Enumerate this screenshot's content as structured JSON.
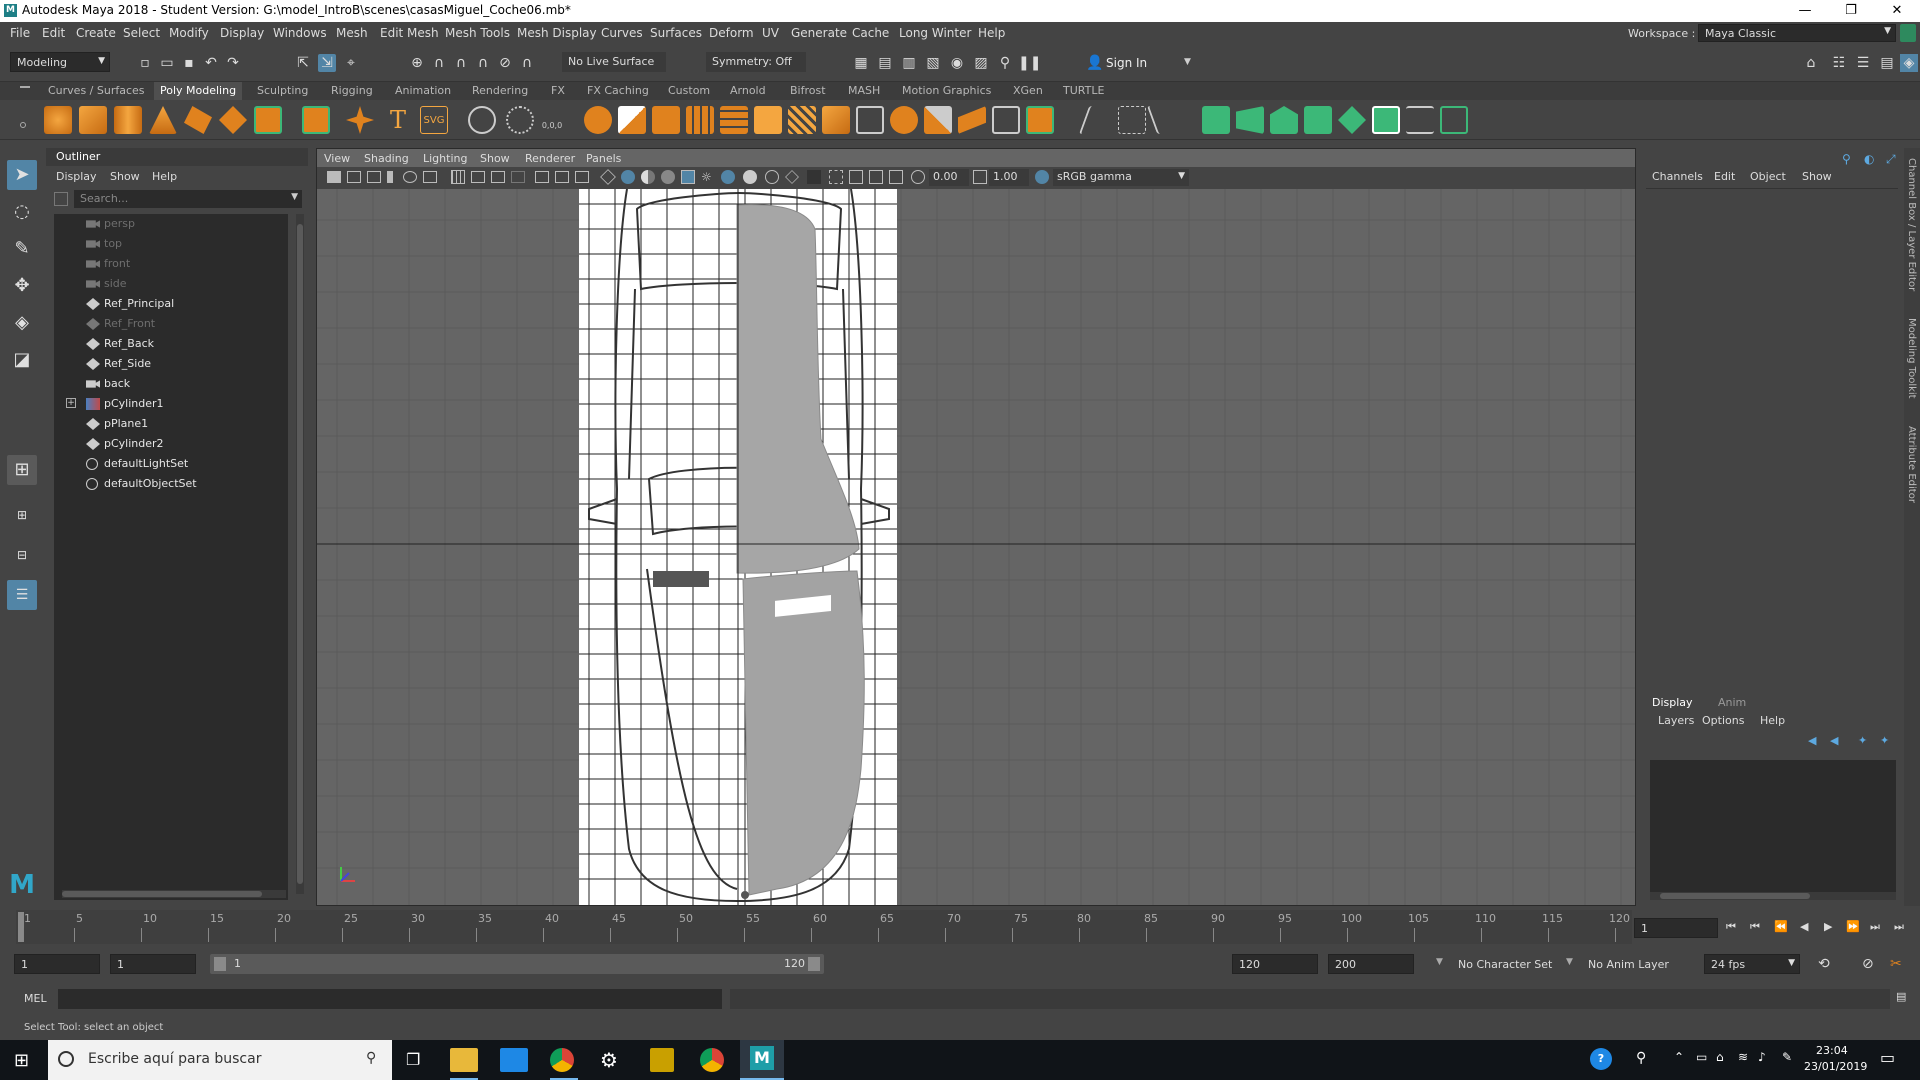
{
  "window": {
    "title": "Autodesk Maya 2018 - Student Version: G:\\model_IntroB\\scenes\\casasMiguel_Coche06.mb*",
    "app_icon": "M",
    "minimize": "—",
    "maximize": "❐",
    "close": "✕"
  },
  "menubar": {
    "items": [
      "File",
      "Edit",
      "Create",
      "Select",
      "Modify",
      "Display",
      "Windows",
      "Mesh",
      "Edit Mesh",
      "Mesh Tools",
      "Mesh Display",
      "Curves",
      "Surfaces",
      "Deform",
      "UV",
      "Generate",
      "Cache",
      "Long Winter",
      "Help"
    ],
    "workspace_label": "Workspace :",
    "workspace_value": "Maya Classic"
  },
  "statusline": {
    "menuset": "Modeling",
    "live_surface": "No Live Surface",
    "symmetry": "Symmetry: Off",
    "sign_in": "Sign In"
  },
  "shelf": {
    "tabs": [
      "Curves / Surfaces",
      "Poly Modeling",
      "Sculpting",
      "Rigging",
      "Animation",
      "Rendering",
      "FX",
      "FX Caching",
      "Custom",
      "Arnold",
      "Bifrost",
      "MASH",
      "Motion Graphics",
      "XGen",
      "TURTLE"
    ],
    "active_tab": "Poly Modeling",
    "svg_label": "SVG",
    "text_label": "T",
    "coord_label": "0,0,0"
  },
  "outliner": {
    "title": "Outliner",
    "menu": [
      "Display",
      "Show",
      "Help"
    ],
    "search_placeholder": "Search...",
    "items": [
      {
        "label": "persp",
        "state": "dim",
        "icon": "camera-icon"
      },
      {
        "label": "top",
        "state": "dim",
        "icon": "camera-icon"
      },
      {
        "label": "front",
        "state": "dim",
        "icon": "camera-icon"
      },
      {
        "label": "side",
        "state": "dim",
        "icon": "camera-icon"
      },
      {
        "label": "Ref_Principal",
        "state": "bright",
        "icon": "transform-icon"
      },
      {
        "label": "Ref_Front",
        "state": "dim",
        "icon": "transform-icon"
      },
      {
        "label": "Ref_Back",
        "state": "bright",
        "icon": "transform-icon"
      },
      {
        "label": "Ref_Side",
        "state": "bright",
        "icon": "transform-icon"
      },
      {
        "label": "back",
        "state": "bright",
        "icon": "camera-icon"
      },
      {
        "label": "pCylinder1",
        "state": "bright",
        "icon": "mesh-icon"
      },
      {
        "label": "pPlane1",
        "state": "bright",
        "icon": "transform-icon"
      },
      {
        "label": "pCylinder2",
        "state": "bright",
        "icon": "transform-icon"
      },
      {
        "label": "defaultLightSet",
        "state": "bright",
        "icon": "set-icon"
      },
      {
        "label": "defaultObjectSet",
        "state": "bright",
        "icon": "set-icon"
      }
    ]
  },
  "viewport": {
    "menu": [
      "View",
      "Shading",
      "Lighting",
      "Show",
      "Renderer",
      "Panels"
    ],
    "exposure": "0.00",
    "gamma": "1.00",
    "color_space": "sRGB gamma"
  },
  "channelbox": {
    "menu": [
      "Channels",
      "Edit",
      "Object",
      "Show"
    ]
  },
  "layereditor": {
    "tabs": [
      "Display",
      "Anim"
    ],
    "menu": [
      "Layers",
      "Options",
      "Help"
    ]
  },
  "sidetabs": [
    "Channel Box / Layer Editor",
    "Modeling Toolkit",
    "Attribute Editor"
  ],
  "timeline": {
    "labels": [
      "1",
      "5",
      "10",
      "15",
      "20",
      "25",
      "30",
      "35",
      "40",
      "45",
      "50",
      "55",
      "60",
      "65",
      "70",
      "75",
      "80",
      "85",
      "90",
      "95",
      "100",
      "105",
      "110",
      "115",
      "120"
    ],
    "current_frame": "1"
  },
  "range": {
    "start": "1",
    "playback_start": "1",
    "range_start_label": "1",
    "range_end_label": "120",
    "playback_end": "120",
    "end": "200",
    "character_set": "No Character Set",
    "anim_layer": "No Anim Layer",
    "fps": "24 fps"
  },
  "cmdline": {
    "label": "MEL"
  },
  "helpline": {
    "text": "Select Tool: select an object"
  },
  "taskbar": {
    "search_placeholder": "Escribe aquí para buscar",
    "time": "23:04",
    "date": "23/01/2019"
  },
  "colors": {
    "accent": "#5285a6",
    "shelf_orange": "#e0821e",
    "shelf_green": "#3cb878",
    "viewport_bg": "#656565"
  }
}
